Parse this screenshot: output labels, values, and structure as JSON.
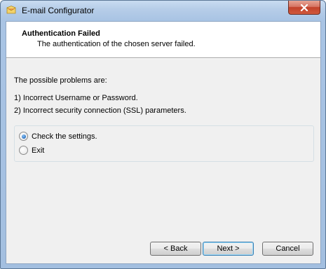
{
  "window": {
    "title": "E-mail Configurator",
    "icons": {
      "app": "envelope-icon",
      "close": "close-icon"
    }
  },
  "header": {
    "title": "Authentication Failed",
    "subtitle": "The authentication of the chosen server failed."
  },
  "body": {
    "intro": "The possible problems are:",
    "problems": [
      "1) Incorrect Username or Password.",
      "2) Incorrect security connection (SSL) parameters."
    ]
  },
  "options": [
    {
      "label": "Check the settings.",
      "checked": true
    },
    {
      "label": "Exit",
      "checked": false
    }
  ],
  "buttons": {
    "back": "< Back",
    "next": "Next >",
    "cancel": "Cancel"
  },
  "colors": {
    "close_button": "#c9503a",
    "radio_selected": "#2a6fbf",
    "default_button_border": "#3c7fb1"
  }
}
